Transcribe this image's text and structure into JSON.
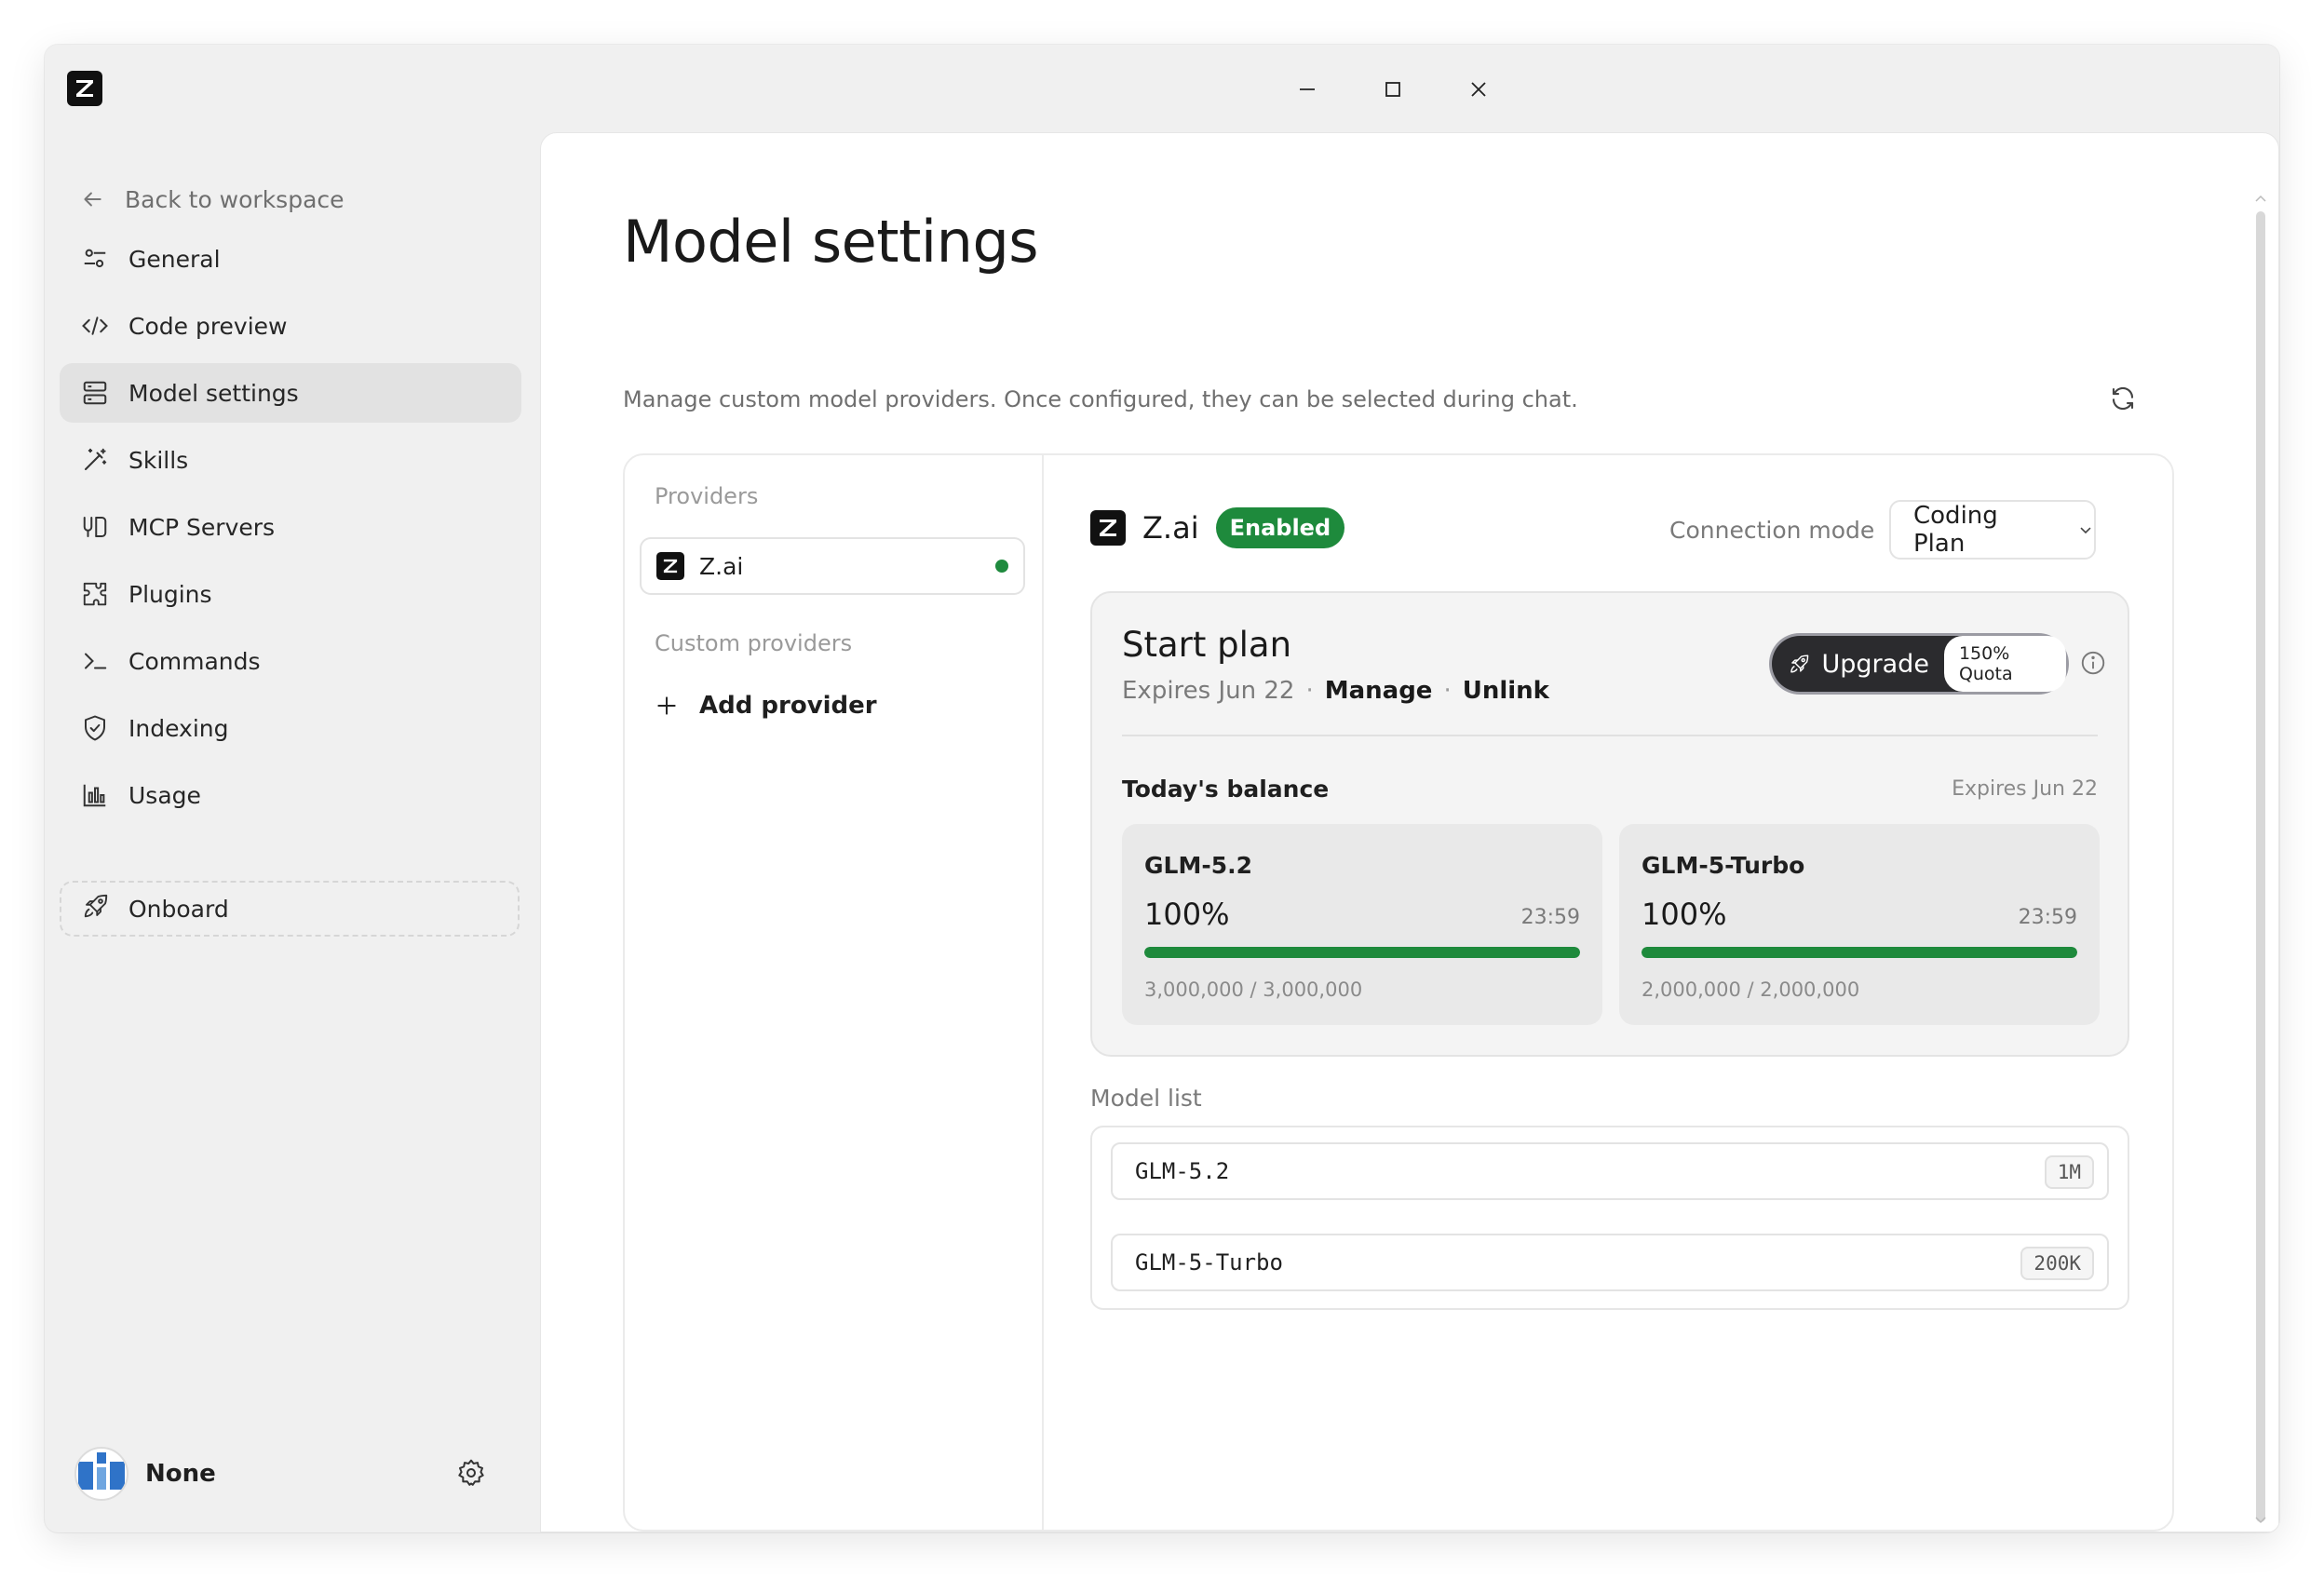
{
  "window": {
    "controls": [
      "minimize-icon",
      "maximize-icon",
      "close-icon"
    ]
  },
  "sidebar": {
    "back_label": "Back to workspace",
    "items": [
      {
        "label": "General",
        "icon": "sliders-icon"
      },
      {
        "label": "Code preview",
        "icon": "code-icon"
      },
      {
        "label": "Model settings",
        "icon": "server-icon",
        "active": true
      },
      {
        "label": "Skills",
        "icon": "magic-wand-icon"
      },
      {
        "label": "MCP Servers",
        "icon": "mcp-icon"
      },
      {
        "label": "Plugins",
        "icon": "puzzle-icon"
      },
      {
        "label": "Commands",
        "icon": "terminal-icon"
      },
      {
        "label": "Indexing",
        "icon": "shield-icon"
      },
      {
        "label": "Usage",
        "icon": "bar-chart-icon"
      }
    ],
    "onboard_label": "Onboard",
    "user": {
      "name": "None"
    }
  },
  "main": {
    "title": "Model settings",
    "description": "Manage custom model providers. Once configured, they can be selected during chat.",
    "providers_label": "Providers",
    "providers": [
      {
        "name": "Z.ai",
        "status": "active"
      }
    ],
    "custom_providers_label": "Custom providers",
    "add_provider_label": "Add provider",
    "detail": {
      "provider_name": "Z.ai",
      "status_badge": "Enabled",
      "connection_mode_label": "Connection mode",
      "connection_mode_value": "Coding Plan",
      "plan": {
        "title": "Start plan",
        "expires": "Expires Jun 22",
        "sep": "·",
        "manage_label": "Manage",
        "unlink_label": "Unlink",
        "upgrade_label": "Upgrade",
        "quota_label": "150% Quota"
      },
      "balance": {
        "label": "Today's balance",
        "expires": "Expires Jun 22",
        "items": [
          {
            "name": "GLM-5.2",
            "percent": "100%",
            "percent_value": 100,
            "time": "23:59",
            "count": "3,000,000 / 3,000,000"
          },
          {
            "name": "GLM-5-Turbo",
            "percent": "100%",
            "percent_value": 100,
            "time": "23:59",
            "count": "2,000,000 / 2,000,000"
          }
        ]
      },
      "model_list_label": "Model list",
      "models": [
        {
          "name": "GLM-5.2",
          "context": "1M"
        },
        {
          "name": "GLM-5-Turbo",
          "context": "200K"
        }
      ]
    }
  },
  "colors": {
    "accent_green": "#1e8a3c",
    "upgrade_bg": "#2b2b2e",
    "active_nav": "#e2e2e2"
  }
}
